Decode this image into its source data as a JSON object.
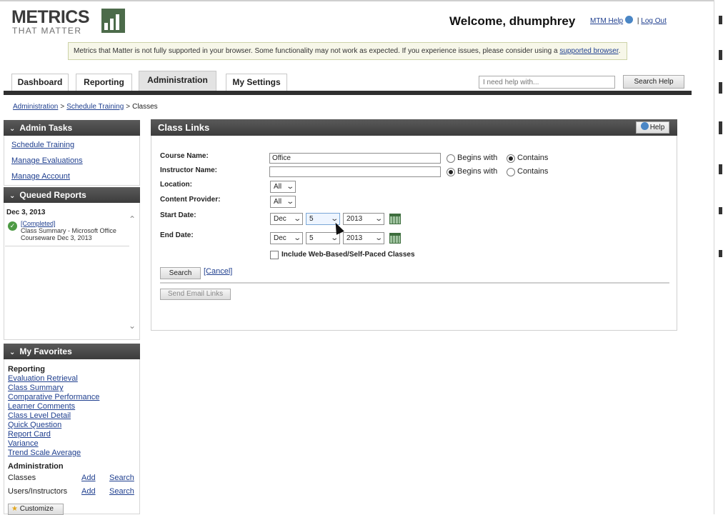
{
  "logo": {
    "line1": "METRICS",
    "line2": "THAT MATTER"
  },
  "header": {
    "welcome": "Welcome, dhumphrey",
    "help_link": "MTM Help",
    "separator": "|",
    "logout_link": "Log Out"
  },
  "notice": {
    "text": "Metrics that Matter is not fully supported in your browser. Some functionality may not work as expected. If you experience issues, please consider using a",
    "link": "supported browser",
    "end": "."
  },
  "tabs": [
    "Dashboard",
    "Reporting",
    "Administration",
    "My Settings"
  ],
  "active_tab": "Administration",
  "help_search": {
    "placeholder": "I need help with...",
    "button": "Search Help"
  },
  "breadcrumb": {
    "items": [
      "Administration",
      "Schedule Training"
    ],
    "separator": ">",
    "current": "Classes"
  },
  "admin_tasks": {
    "title": "Admin Tasks",
    "links": [
      "Schedule Training",
      "Manage Evaluations",
      "Manage Account"
    ]
  },
  "queued_reports": {
    "title": "Queued Reports",
    "date": "Dec 3, 2013",
    "item": {
      "status": "[Completed]",
      "name": "Class Summary - Microsoft Office Courseware",
      "date": "Dec 3, 2013"
    }
  },
  "favorites": {
    "title": "My Favorites",
    "reporting_heading": "Reporting",
    "reporting_links": [
      "Evaluation Retrieval",
      "Class Summary",
      "Comparative Performance",
      "Learner Comments",
      "Class Level Detail",
      "Quick Question",
      "Report Card",
      "Variance",
      "Trend Scale Average"
    ],
    "admin_heading": "Administration",
    "admin_rows": [
      {
        "label": "Classes",
        "add": "Add",
        "search": "Search"
      },
      {
        "label": "Users/Instructors",
        "add": "Add",
        "search": "Search"
      }
    ],
    "customize": "Customize"
  },
  "class_links": {
    "title": "Class Links",
    "help": "Help",
    "course_name": {
      "label": "Course Name:",
      "value": "Office",
      "options": [
        "Begins with",
        "Contains"
      ],
      "selected": "Contains"
    },
    "instructor_name": {
      "label": "Instructor Name:",
      "value": "",
      "options": [
        "Begins with",
        "Contains"
      ],
      "selected": "Begins with"
    },
    "location": {
      "label": "Location:",
      "value": "All"
    },
    "content_provider": {
      "label": "Content Provider:",
      "value": "All"
    },
    "start_date": {
      "label": "Start Date:",
      "month": "Dec",
      "day": "5",
      "year": "2013"
    },
    "end_date": {
      "label": "End Date:",
      "month": "Dec",
      "day": "5",
      "year": "2013"
    },
    "include_web": {
      "label": "Include Web-Based/Self-Paced Classes",
      "checked": false
    },
    "search_button": "Search",
    "cancel_link": "[Cancel]",
    "send_email_button": "Send Email Links"
  }
}
